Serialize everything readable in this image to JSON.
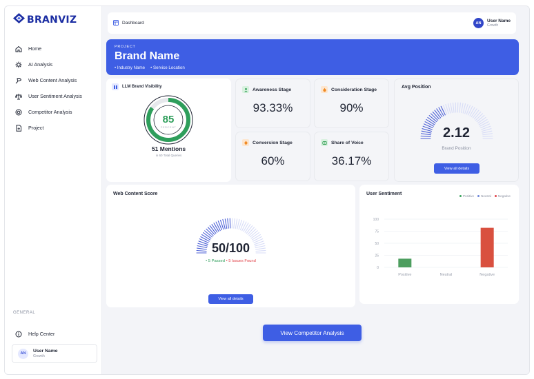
{
  "brand": {
    "logo_text": "BRANVIZ"
  },
  "sidebar": {
    "items": [
      {
        "label": "Home",
        "icon": "home-icon"
      },
      {
        "label": "AI Analysis",
        "icon": "ai-icon"
      },
      {
        "label": "Web Content Analysis",
        "icon": "web-icon"
      },
      {
        "label": "User Sentiment Analysis",
        "icon": "sentiment-icon"
      },
      {
        "label": "Competitor Analysis",
        "icon": "competitor-icon"
      },
      {
        "label": "Project",
        "icon": "project-icon"
      }
    ],
    "section_general": "GENERAL",
    "help_label": "Help Center",
    "user": {
      "initials": "AN",
      "name": "User Name",
      "role": "Growth"
    }
  },
  "topbar": {
    "breadcrumb": "Dashboard",
    "user": {
      "initials": "AN",
      "name": "User Name",
      "role": "Growth"
    }
  },
  "banner": {
    "label": "PROJECT",
    "title": "Brand Name",
    "industry": "• Industry Name",
    "location": "• Service Location"
  },
  "llm": {
    "title": "LLM Brand Visibility",
    "percent": 85,
    "percent_text": "85",
    "percent_label": "PERCENT",
    "mentions": "51 Mentions",
    "queries": "in 60 Total Queries"
  },
  "stages": [
    {
      "label": "Awareness Stage",
      "value": "93.33%",
      "color": "#3aa35c",
      "bg": "#d8f1df"
    },
    {
      "label": "Consideration Stage",
      "value": "90%",
      "color": "#f08a24",
      "bg": "#fde6cf"
    },
    {
      "label": "Conversion Stage",
      "value": "60%",
      "color": "#f08a24",
      "bg": "#fde6cf"
    },
    {
      "label": "Share of Voice",
      "value": "36.17%",
      "color": "#3aa35c",
      "bg": "#d8f1df"
    }
  ],
  "avg_position": {
    "title": "Avg Position",
    "value": "2.12",
    "label": "Brand Position",
    "button": "View all details"
  },
  "web_content": {
    "title": "Web Content Score",
    "value": "50/100",
    "score": 50,
    "passed": "• 5 Passed",
    "issues": "• 5 Issues Found",
    "button": "View all details"
  },
  "sentiment": {
    "title": "User Sentiment",
    "legend": [
      "Positive",
      "Neutral",
      "Negative"
    ]
  },
  "chart_data": {
    "type": "bar",
    "title": "User Sentiment",
    "categories": [
      "Positive",
      "Neutral",
      "Negative"
    ],
    "values": [
      18,
      0,
      82
    ],
    "colors": [
      "#4d9e5f",
      "#9aa3b5",
      "#d9503f"
    ],
    "yticks": [
      100,
      75,
      50,
      25,
      0
    ],
    "ylim": [
      0,
      100
    ],
    "grid": true,
    "legend_position": "top-right"
  },
  "cta": {
    "label": "View Competitor Analysis"
  },
  "colors": {
    "accent": "#3e5ee4",
    "positive": "#3aa35c",
    "negative": "#e0444a",
    "brand": "#1c2ea3"
  }
}
